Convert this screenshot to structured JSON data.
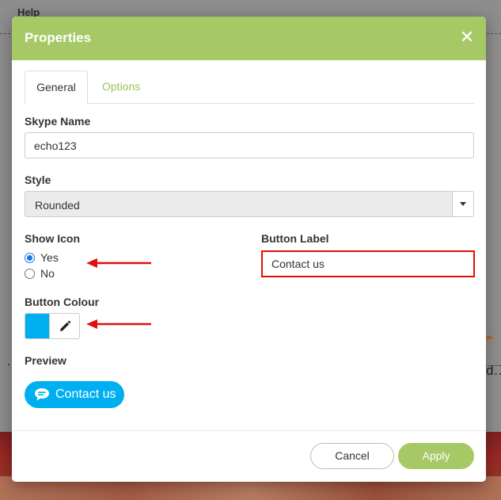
{
  "background": {
    "menu_label": "Help",
    "ellipsis_left": "…",
    "ellipsis_right": "d…"
  },
  "modal": {
    "title": "Properties",
    "close_symbol": "✕",
    "tabs": [
      {
        "label": "General",
        "active": true
      },
      {
        "label": "Options",
        "active": false
      }
    ],
    "skype_name": {
      "label": "Skype Name",
      "value": "echo123"
    },
    "style": {
      "label": "Style",
      "value": "Rounded"
    },
    "show_icon": {
      "label": "Show Icon",
      "options": [
        {
          "label": "Yes",
          "checked": true
        },
        {
          "label": "No",
          "checked": false
        }
      ]
    },
    "button_label": {
      "label": "Button Label",
      "value": "Contact us"
    },
    "button_colour": {
      "label": "Button Colour",
      "swatch_color": "#00aff0",
      "edit_icon": "pencil-icon"
    },
    "preview": {
      "label": "Preview",
      "button_text": "Contact us",
      "icon": "chat-bubble-icon"
    },
    "footer": {
      "cancel_label": "Cancel",
      "apply_label": "Apply"
    }
  },
  "colors": {
    "header": "#a6c865",
    "accent_green": "#9cc15a",
    "skype_blue": "#00aff0",
    "annotation_red": "#e00f0f"
  }
}
